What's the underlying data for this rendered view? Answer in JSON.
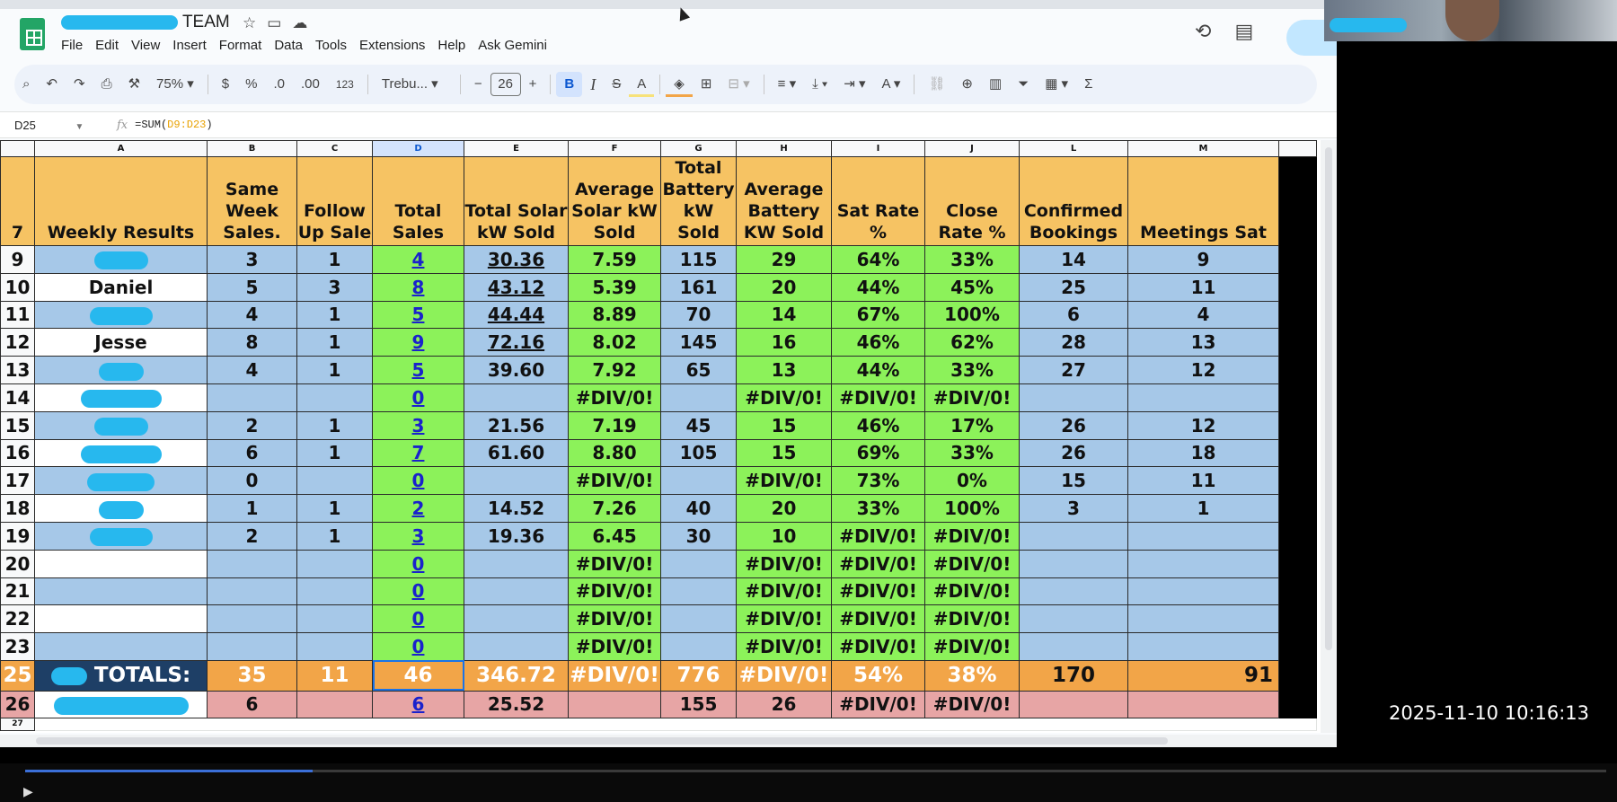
{
  "app": {
    "title_suffix": "TEAM",
    "menu": [
      "File",
      "Edit",
      "View",
      "Insert",
      "Format",
      "Data",
      "Tools",
      "Extensions",
      "Help",
      "Ask Gemini"
    ]
  },
  "toolbar": {
    "zoom": "75%",
    "currency": "$",
    "percent": "%",
    "dec_decrease": ".0",
    "dec_increase": ".00",
    "number_format": "123",
    "font": "Trebu...",
    "font_size": "26",
    "bold": "B",
    "italic": "I",
    "strike": "S",
    "text_color": "A"
  },
  "formula_bar": {
    "cell_ref": "D25",
    "fx": "fx",
    "formula_prefix": "=SUM(",
    "formula_range": "D9:D23",
    "formula_suffix": ")"
  },
  "sheet": {
    "col_letters": [
      "A",
      "B",
      "C",
      "D",
      "E",
      "F",
      "G",
      "H",
      "I",
      "J",
      "L",
      "M"
    ],
    "header_row_num": "7",
    "headers": [
      "Weekly Results",
      "Same Week Sales.",
      "Follow Up Sale",
      "Total Sales",
      "Total Solar kW Sold",
      "Average Solar kW Sold",
      "Total Battery kW Sold",
      "Average Battery KW Sold",
      "Sat Rate %",
      "Close Rate %",
      "Confirmed Bookings",
      "Meetings Sat"
    ],
    "rows": [
      {
        "num": "9",
        "name": "",
        "b": "3",
        "c": "1",
        "d": "4",
        "e": "30.36",
        "f": "7.59",
        "g": "115",
        "h": "29",
        "i": "64%",
        "j": "33%",
        "l": "14",
        "m": "9"
      },
      {
        "num": "10",
        "name": "Daniel",
        "b": "5",
        "c": "3",
        "d": "8",
        "e": "43.12",
        "f": "5.39",
        "g": "161",
        "h": "20",
        "i": "44%",
        "j": "45%",
        "l": "25",
        "m": "11"
      },
      {
        "num": "11",
        "name": "",
        "b": "4",
        "c": "1",
        "d": "5",
        "e": "44.44",
        "f": "8.89",
        "g": "70",
        "h": "14",
        "i": "67%",
        "j": "100%",
        "l": "6",
        "m": "4"
      },
      {
        "num": "12",
        "name": "Jesse",
        "b": "8",
        "c": "1",
        "d": "9",
        "e": "72.16",
        "f": "8.02",
        "g": "145",
        "h": "16",
        "i": "46%",
        "j": "62%",
        "l": "28",
        "m": "13"
      },
      {
        "num": "13",
        "name": "",
        "b": "4",
        "c": "1",
        "d": "5",
        "e": "39.60",
        "f": "7.92",
        "g": "65",
        "h": "13",
        "i": "44%",
        "j": "33%",
        "l": "27",
        "m": "12"
      },
      {
        "num": "14",
        "name": "",
        "b": "",
        "c": "",
        "d": "0",
        "e": "",
        "f": "#DIV/0!",
        "g": "",
        "h": "#DIV/0!",
        "i": "#DIV/0!",
        "j": "#DIV/0!",
        "l": "",
        "m": ""
      },
      {
        "num": "15",
        "name": "",
        "b": "2",
        "c": "1",
        "d": "3",
        "e": "21.56",
        "f": "7.19",
        "g": "45",
        "h": "15",
        "i": "46%",
        "j": "17%",
        "l": "26",
        "m": "12"
      },
      {
        "num": "16",
        "name": "",
        "b": "6",
        "c": "1",
        "d": "7",
        "e": "61.60",
        "f": "8.80",
        "g": "105",
        "h": "15",
        "i": "69%",
        "j": "33%",
        "l": "26",
        "m": "18"
      },
      {
        "num": "17",
        "name": "",
        "b": "0",
        "c": "",
        "d": "0",
        "e": "",
        "f": "#DIV/0!",
        "g": "",
        "h": "#DIV/0!",
        "i": "73%",
        "j": "0%",
        "l": "15",
        "m": "11"
      },
      {
        "num": "18",
        "name": "",
        "b": "1",
        "c": "1",
        "d": "2",
        "e": "14.52",
        "f": "7.26",
        "g": "40",
        "h": "20",
        "i": "33%",
        "j": "100%",
        "l": "3",
        "m": "1"
      },
      {
        "num": "19",
        "name": "",
        "b": "2",
        "c": "1",
        "d": "3",
        "e": "19.36",
        "f": "6.45",
        "g": "30",
        "h": "10",
        "i": "#DIV/0!",
        "j": "#DIV/0!",
        "l": "",
        "m": ""
      },
      {
        "num": "20",
        "name": "",
        "b": "",
        "c": "",
        "d": "0",
        "e": "",
        "f": "#DIV/0!",
        "g": "",
        "h": "#DIV/0!",
        "i": "#DIV/0!",
        "j": "#DIV/0!",
        "l": "",
        "m": ""
      },
      {
        "num": "21",
        "name": "",
        "b": "",
        "c": "",
        "d": "0",
        "e": "",
        "f": "#DIV/0!",
        "g": "",
        "h": "#DIV/0!",
        "i": "#DIV/0!",
        "j": "#DIV/0!",
        "l": "",
        "m": ""
      },
      {
        "num": "22",
        "name": "",
        "b": "",
        "c": "",
        "d": "0",
        "e": "",
        "f": "#DIV/0!",
        "g": "",
        "h": "#DIV/0!",
        "i": "#DIV/0!",
        "j": "#DIV/0!",
        "l": "",
        "m": ""
      },
      {
        "num": "23",
        "name": "",
        "b": "",
        "c": "",
        "d": "0",
        "e": "",
        "f": "#DIV/0!",
        "g": "",
        "h": "#DIV/0!",
        "i": "#DIV/0!",
        "j": "#DIV/0!",
        "l": "",
        "m": ""
      }
    ],
    "totals": {
      "num": "25",
      "label": "TOTALS:",
      "b": "35",
      "c": "11",
      "d": "46",
      "e": "346.72",
      "f": "#DIV/0!",
      "g": "776",
      "h": "#DIV/0!",
      "i": "54%",
      "j": "38%",
      "l": "170",
      "m": "91"
    },
    "row26": {
      "num": "26",
      "b": "6",
      "c": "",
      "d": "6",
      "e": "25.52",
      "f": "",
      "g": "155",
      "h": "26",
      "i": "#DIV/0!",
      "j": "#DIV/0!",
      "l": "",
      "m": ""
    },
    "row27": {
      "num": "27"
    }
  },
  "video": {
    "timestamp": "2025-11-10  10:16:13"
  }
}
